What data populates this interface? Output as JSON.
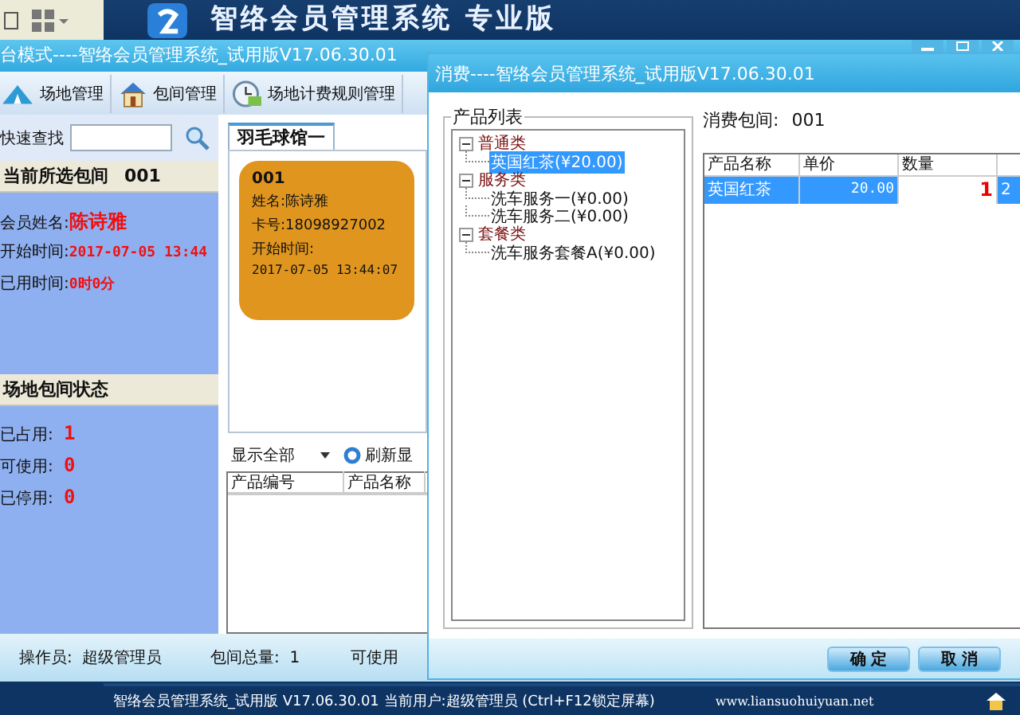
{
  "desktop": {
    "banner_title": "智络会员管理系统 专业版",
    "status_text": "智络会员管理系统_试用版 V17.06.30.01 当前用户:超级管理员 (Ctrl+F12锁定屏幕)",
    "website": "www.liansuohuiyuan.net"
  },
  "main_window": {
    "title": "台模式----智络会员管理系统_试用版V17.06.30.01",
    "toolbar": [
      {
        "label": "场地管理",
        "kind": "tent"
      },
      {
        "label": "包间管理",
        "kind": "house"
      },
      {
        "label": "场地计费规则管理",
        "kind": "clock"
      }
    ],
    "quick_search": {
      "label": "快速查找"
    },
    "current_room": {
      "title": "当前所选包间",
      "room": "001",
      "fields": [
        {
          "label": "会员姓名:",
          "value": "陈诗雅"
        },
        {
          "label": "开始时间:",
          "value": "2017-07-05 13:44"
        },
        {
          "label": "已用时间:",
          "value": "0时0分"
        }
      ]
    },
    "room_status": {
      "title": "场地包间状态",
      "fields": [
        {
          "label": "已占用:",
          "value": "1"
        },
        {
          "label": "可使用:",
          "value": "0"
        },
        {
          "label": "已停用:",
          "value": "0"
        }
      ]
    },
    "tabs": [
      {
        "label": "羽毛球馆一",
        "selected": true
      }
    ],
    "room_cards": [
      {
        "number": "001",
        "lines": [
          "姓名:陈诗雅",
          "卡号:18098927002",
          "开始时间:",
          "2017-07-05 13:44:07"
        ]
      }
    ],
    "filter": {
      "value": "显示全部"
    },
    "refresh_button": "刷新显",
    "product_table": {
      "columns": [
        "产品编号",
        "产品名称"
      ]
    },
    "status_bar": [
      {
        "label": "操作员:",
        "value": "超级管理员"
      },
      {
        "label": "包间总量:",
        "value": "1"
      },
      {
        "label": "可使用"
      }
    ]
  },
  "dialog": {
    "title": "消费----智络会员管理系统_试用版V17.06.30.01",
    "product_list": {
      "title": "产品列表",
      "tree": [
        {
          "label": "普通类",
          "expanded": true,
          "selected": false,
          "children": [
            {
              "label": "英国红茶(¥20.00)",
              "selected": true
            }
          ]
        },
        {
          "label": "服务类",
          "expanded": true,
          "selected": false,
          "children": [
            {
              "label": "洗车服务一(¥0.00)",
              "selected": false
            },
            {
              "label": "洗车服务二(¥0.00)",
              "selected": false
            }
          ]
        },
        {
          "label": "套餐类",
          "expanded": true,
          "selected": false,
          "children": [
            {
              "label": "洗车服务套餐A(¥0.00)",
              "selected": false
            }
          ]
        }
      ]
    },
    "room_label": "消费包间:",
    "room": "001",
    "grid": {
      "columns": [
        "产品名称",
        "单价",
        "数量"
      ],
      "rows": [
        {
          "cells": [
            "英国红茶",
            "20.00",
            "1",
            "2"
          ],
          "selected": true
        }
      ]
    },
    "buttons": [
      "确 定",
      "取 消"
    ]
  }
}
